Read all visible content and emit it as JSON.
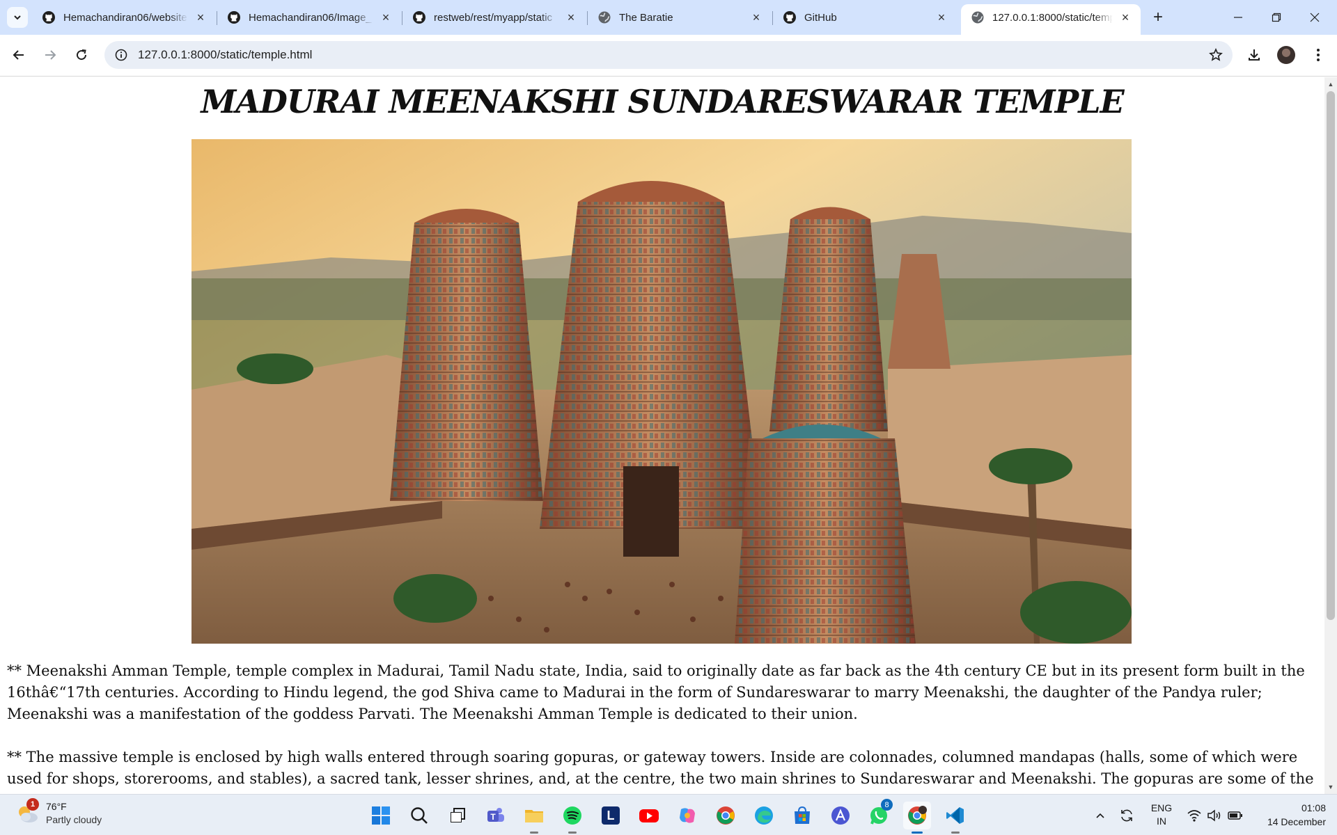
{
  "browser": {
    "tabs": [
      {
        "title": "Hemachandiran06/website",
        "favicon": "github-icon",
        "active": false
      },
      {
        "title": "Hemachandiran06/Image_",
        "favicon": "github-icon",
        "active": false
      },
      {
        "title": "restweb/rest/myapp/static",
        "favicon": "github-icon",
        "active": false
      },
      {
        "title": "The Baratie",
        "favicon": "globe-icon",
        "active": false
      },
      {
        "title": "GitHub",
        "favicon": "github-icon",
        "active": false
      },
      {
        "title": "127.0.0.1:8000/static/temp",
        "favicon": "globe-icon",
        "active": true
      }
    ],
    "address_bar": {
      "url": "127.0.0.1:8000/static/temple.html"
    }
  },
  "page": {
    "title": "MADURAI MEENAKSHI SUNDARESWARAR TEMPLE",
    "image_alt": "Madurai Meenakshi Temple gopuras",
    "paragraphs": [
      "** Meenakshi Amman Temple, temple complex in Madurai, Tamil Nadu state, India, said to originally date as far back as the 4th century CE but in its present form built in the 16thâ€“17th centuries. According to Hindu legend, the god Shiva came to Madurai in the form of Sundareswarar to marry Meenakshi, the daughter of the Pandya ruler; Meenakshi was a manifestation of the goddess Parvati. The Meenakshi Amman Temple is dedicated to their union.",
      "** The massive temple is enclosed by high walls entered through soaring gopuras, or gateway towers. Inside are colonnades, columned mandapas (halls, some of which were used for shops, storerooms, and stables), a sacred tank, lesser shrines, and, at the centre, the two main shrines to Sundareswarar and Meenakshi. The gopuras are some of the most"
    ]
  },
  "taskbar": {
    "weather": {
      "badge": "1",
      "temperature": "76°F",
      "condition": "Partly cloudy"
    },
    "apps": [
      {
        "name": "windows-start-icon"
      },
      {
        "name": "search-icon"
      },
      {
        "name": "task-view-icon"
      },
      {
        "name": "teams-icon"
      },
      {
        "name": "file-explorer-icon"
      },
      {
        "name": "spotify-icon"
      },
      {
        "name": "l-app-icon",
        "label": "L"
      },
      {
        "name": "youtube-icon"
      },
      {
        "name": "copilot-icon"
      },
      {
        "name": "chrome-icon"
      },
      {
        "name": "edge-icon"
      },
      {
        "name": "microsoft-store-icon"
      },
      {
        "name": "app-a-icon"
      },
      {
        "name": "whatsapp-icon",
        "badge": "8"
      },
      {
        "name": "chrome-profile-icon"
      },
      {
        "name": "vscode-icon"
      }
    ],
    "language": {
      "line1": "ENG",
      "line2": "IN"
    },
    "clock": {
      "time": "01:08",
      "date": "14 December"
    }
  }
}
